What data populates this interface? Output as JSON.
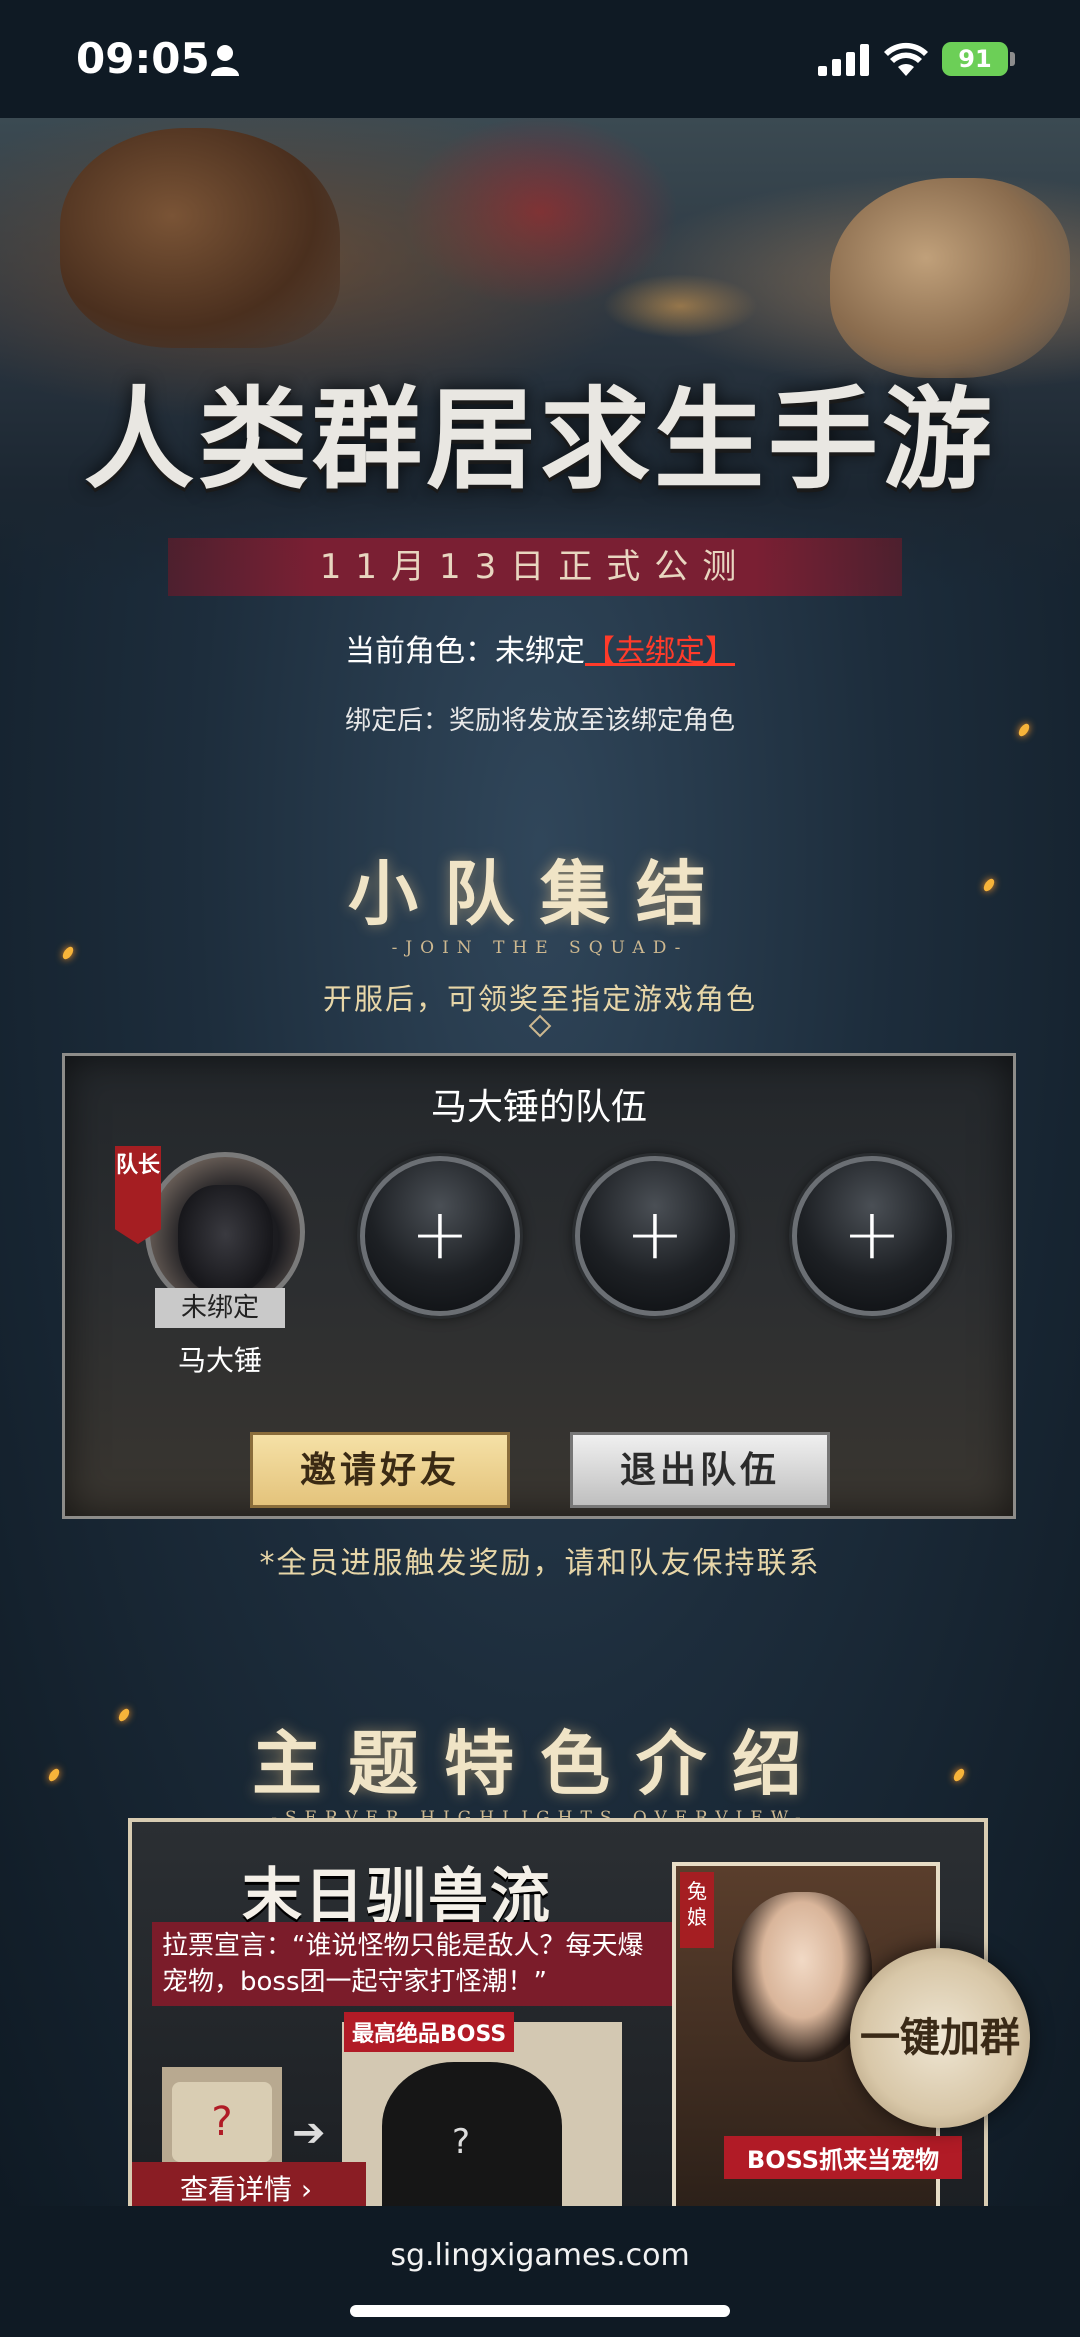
{
  "status": {
    "time": "09:05",
    "battery": "91"
  },
  "hero": {
    "title": "人类群居求生手游",
    "date": "11月13日正式公测"
  },
  "binding": {
    "role_prefix": "当前角色：未绑定",
    "bind_link": "【去绑定】",
    "note": "绑定后：奖励将发放至该绑定角色"
  },
  "squad": {
    "title": "小队集结",
    "subtitle": "-JOIN THE SQUAD-",
    "desc": "开服后，可领奖至指定游戏角色",
    "team_name": "马大锤的队伍",
    "leader_badge": "队长",
    "leader_status": "未绑定",
    "leader_name": "马大锤",
    "add_symbol": "+",
    "invite_label": "邀请好友",
    "leave_label": "退出队伍",
    "hint": "*全员进服触发奖励，请和队友保持联系"
  },
  "features": {
    "title": "主题特色介绍",
    "subtitle": "-SERVER HIGHLIGHTS OVERVIEW-",
    "card_title": "末日驯兽流",
    "card_desc": "拉票宣言：“谁说怪物只能是敌人？每天爆宠物，boss团一起守家打怪潮！”",
    "boss_label": "最高绝品BOSS",
    "view_detail": "查看详情",
    "girl_tag": "兔娘",
    "pet_banner": "BOSS抓来当宠物",
    "join_group": "一键加群"
  },
  "browser": {
    "url": "sg.lingxigames.com"
  },
  "colors": {
    "accent_red": "#ff3b2a",
    "gold": "#e7d6a8",
    "background": "#0f1a24"
  }
}
